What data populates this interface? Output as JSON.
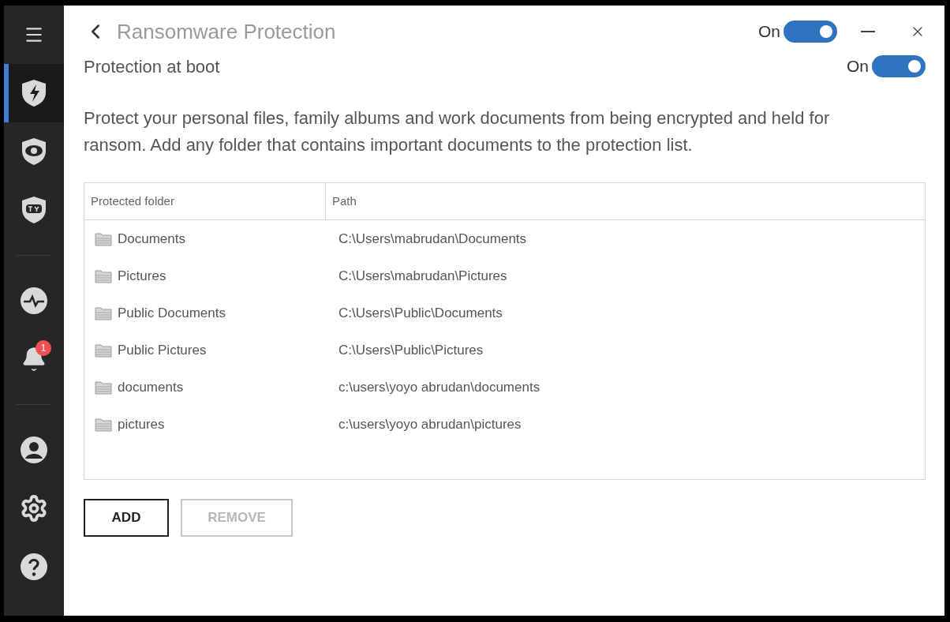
{
  "sidebar": {
    "items": [
      {
        "kind": "menu",
        "selected": false
      },
      {
        "kind": "ransomware",
        "selected": true
      },
      {
        "kind": "privacy",
        "selected": false
      },
      {
        "kind": "tv",
        "selected": false
      },
      {
        "kind": "divider"
      },
      {
        "kind": "activity",
        "selected": false
      },
      {
        "kind": "notifications",
        "selected": false,
        "badge": "1"
      },
      {
        "kind": "divider"
      },
      {
        "kind": "account",
        "selected": false
      },
      {
        "kind": "settings",
        "selected": false
      },
      {
        "kind": "help",
        "selected": false
      }
    ]
  },
  "header": {
    "title": "Ransomware Protection",
    "toggle": {
      "label": "On",
      "on": true
    }
  },
  "boot": {
    "label": "Protection at boot",
    "toggle": {
      "label": "On",
      "on": true
    }
  },
  "description": "Protect your personal files, family albums and work documents from being encrypted and held for ransom. Add any folder that contains important documents to the protection list.",
  "table": {
    "columns": [
      "Protected folder",
      "Path"
    ],
    "rows": [
      {
        "folder": "Documents",
        "path": "C:\\Users\\mabrudan\\Documents"
      },
      {
        "folder": "Pictures",
        "path": "C:\\Users\\mabrudan\\Pictures"
      },
      {
        "folder": "Public Documents",
        "path": "C:\\Users\\Public\\Documents"
      },
      {
        "folder": "Public Pictures",
        "path": "C:\\Users\\Public\\Pictures"
      },
      {
        "folder": "documents",
        "path": "c:\\users\\yoyo abrudan\\documents"
      },
      {
        "folder": "pictures",
        "path": "c:\\users\\yoyo abrudan\\pictures"
      }
    ]
  },
  "buttons": [
    {
      "label": "ADD",
      "disabled": false
    },
    {
      "label": "REMOVE",
      "disabled": true
    }
  ]
}
